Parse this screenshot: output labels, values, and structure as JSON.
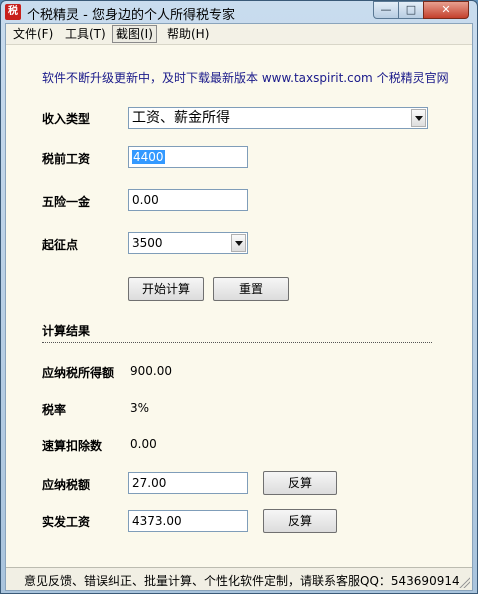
{
  "window": {
    "icon_glyph": "税",
    "title": "个税精灵 - 您身边的个人所得税专家",
    "min_glyph": "—",
    "max_glyph": "□",
    "close_glyph": "✕"
  },
  "menu": [
    {
      "label": "文件(F)"
    },
    {
      "label": "工具(T)"
    },
    {
      "label": "截图(I)"
    },
    {
      "label": "帮助(H)"
    }
  ],
  "notice": "软件不断升级更新中，及时下载最新版本 www.taxspirit.com 个税精灵官网",
  "form": {
    "income_type_label": "收入类型",
    "income_type_value": "工资、薪金所得",
    "pretax_label": "税前工资",
    "pretax_value": "4400",
    "insurance_label": "五险一金",
    "insurance_value": "0.00",
    "threshold_label": "起征点",
    "threshold_value": "3500",
    "calculate_label": "开始计算",
    "reset_label": "重置"
  },
  "results": {
    "header": "计算结果",
    "taxable_income_label": "应纳税所得额",
    "taxable_income_value": "900.00",
    "tax_rate_label": "税率",
    "tax_rate_value": "3%",
    "quick_deduction_label": "速算扣除数",
    "quick_deduction_value": "0.00",
    "tax_payable_label": "应纳税额",
    "tax_payable_value": "27.00",
    "reverse_label": "反算",
    "net_salary_label": "实发工资",
    "net_salary_value": "4373.00"
  },
  "status": "意见反馈、错误纠正、批量计算、个性化软件定制，请联系客服QQ：543690914"
}
